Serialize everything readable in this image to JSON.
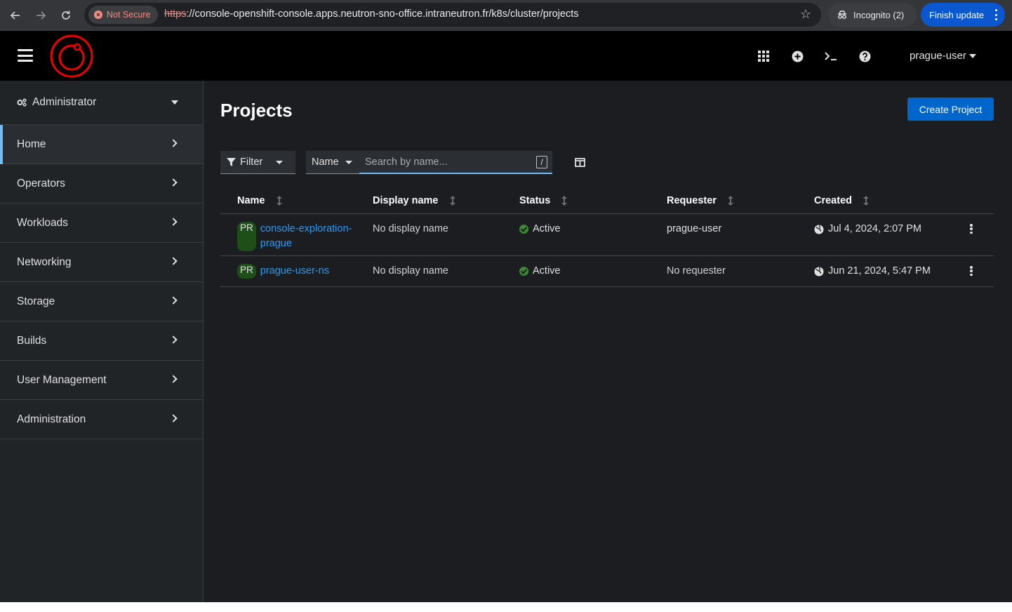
{
  "browser": {
    "security_label": "Not Secure",
    "url_protocol": "https",
    "url_rest": "://console-openshift-console.apps.neutron-sno-office.intraneutron.fr/k8s/cluster/projects",
    "incognito_label": "Incognito (2)",
    "finish_update_label": "Finish update"
  },
  "masthead": {
    "user_menu_label": "prague-user"
  },
  "sidebar": {
    "perspective_label": "Administrator",
    "items": [
      {
        "label": "Home"
      },
      {
        "label": "Operators"
      },
      {
        "label": "Workloads"
      },
      {
        "label": "Networking"
      },
      {
        "label": "Storage"
      },
      {
        "label": "Builds"
      },
      {
        "label": "User Management"
      },
      {
        "label": "Administration"
      }
    ]
  },
  "main": {
    "title": "Projects",
    "create_button_label": "Create Project",
    "filter_label": "Filter",
    "name_select_label": "Name",
    "search_placeholder": "Search by name...",
    "search_shortcut": "/"
  },
  "table": {
    "columns": [
      "Name",
      "Display name",
      "Status",
      "Requester",
      "Created"
    ],
    "rows": [
      {
        "badge": "PR",
        "name": "console-exploration-prague",
        "display_name": "No display name",
        "status": "Active",
        "requester": "prague-user",
        "created": "Jul 4, 2024, 2:07 PM"
      },
      {
        "badge": "PR",
        "name": "prague-user-ns",
        "display_name": "No display name",
        "status": "Active",
        "requester": "No requester",
        "created": "Jun 21, 2024, 5:47 PM"
      }
    ]
  },
  "colors": {
    "accent": "#0066cc",
    "link": "#2b9af3",
    "status_active": "#3e8635",
    "logo_red": "#ee0000"
  }
}
